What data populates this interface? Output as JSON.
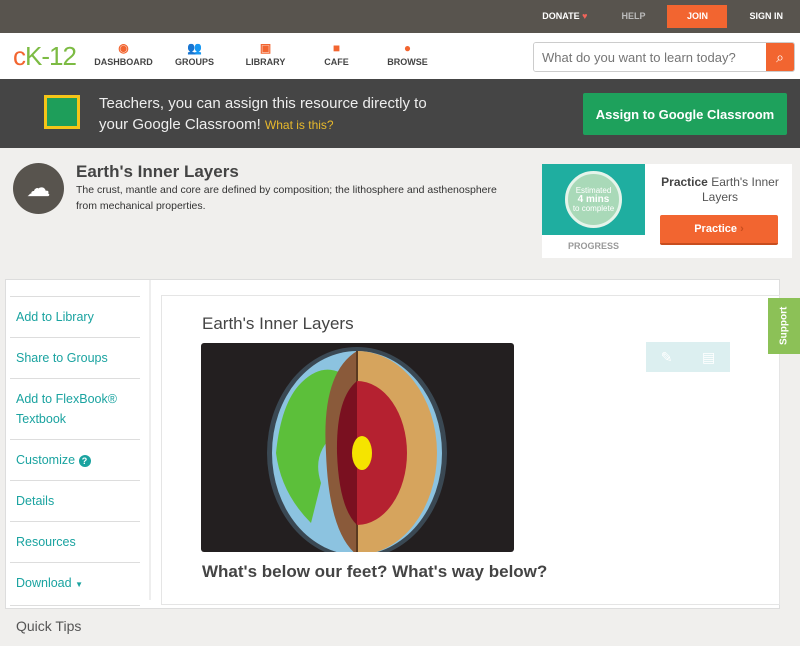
{
  "topbar": {
    "donate": "DONATE",
    "help": "HELP",
    "join": "JOIN",
    "signin": "SIGN IN"
  },
  "nav": {
    "logo": "cK-12",
    "items": [
      {
        "label": "DASHBOARD"
      },
      {
        "label": "GROUPS"
      },
      {
        "label": "LIBRARY"
      },
      {
        "label": "CAFE"
      },
      {
        "label": "BROWSE"
      }
    ],
    "search_placeholder": "What do you want to learn today?"
  },
  "banner": {
    "line1": "Teachers, you can assign this resource directly to",
    "line2": "your Google Classroom!",
    "what": "What is this?",
    "assign": "Assign to Google Classroom"
  },
  "concept": {
    "title": "Earth's Inner Layers",
    "description": "The crust, mantle and core are defined by composition; the lithosphere and asthenosphere from mechanical properties."
  },
  "practice": {
    "est1": "Estimated",
    "est2": "4 mins",
    "est3": "to complete",
    "progress": "PROGRESS",
    "title_bold": "Practice",
    "title_rest": "Earth's Inner Layers",
    "button": "Practice"
  },
  "sidebar": {
    "items": [
      {
        "label": "Add to Library"
      },
      {
        "label": "Share to Groups"
      },
      {
        "label": "Add to FlexBook® Textbook"
      },
      {
        "label": "Customize"
      },
      {
        "label": "Details"
      },
      {
        "label": "Resources"
      },
      {
        "label": "Download"
      }
    ],
    "quick_tips": "Quick Tips"
  },
  "content": {
    "title": "Earth's Inner Layers",
    "heading": "What's below our feet? What's way below?"
  },
  "support": "Support"
}
